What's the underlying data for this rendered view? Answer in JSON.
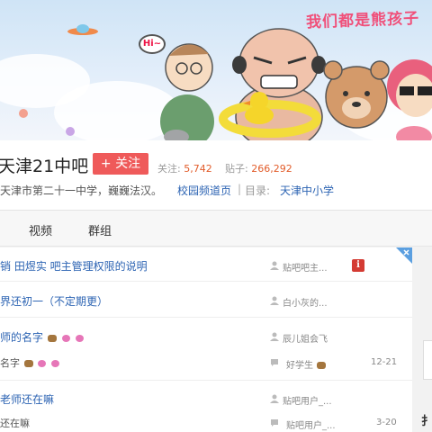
{
  "banner": {
    "slogan": "我们都是熊孩子",
    "hi_bubble": "Hi~"
  },
  "forum": {
    "name": "天津21中吧",
    "follow_label": "+ 关注",
    "follow_count_label": "关注:",
    "follow_count": "5,742",
    "post_count_label": "贴子:",
    "post_count": "266,292",
    "slogan": "天津市第二十一中学，巍巍法汉。",
    "link_campus": "校园频道页",
    "separator": "|",
    "directory_label": "目录:",
    "directory_value": "天津中小学"
  },
  "tabs": [
    "视频",
    "群组"
  ],
  "threads": [
    {
      "title": "销 田煜实 吧主管理权限的说明",
      "author": "贴吧吧主..."
    },
    {
      "title": "界还初一（不定期更）",
      "author": "白小灰的..."
    },
    {
      "title": "师的名字",
      "author": "辰儿姐会飞",
      "desc": "名字",
      "reply_author": "好学生",
      "date": "12-21"
    },
    {
      "title": "老师还在嘛",
      "author": "贴吧用户_...",
      "desc": "还在嘛",
      "reply_author": "贴吧用户_...",
      "date": "3-20"
    }
  ],
  "right_panel": {
    "label": "扌"
  },
  "colors": {
    "accent": "#ef5a5a",
    "link": "#2d64b3",
    "number": "#e25c2a"
  }
}
